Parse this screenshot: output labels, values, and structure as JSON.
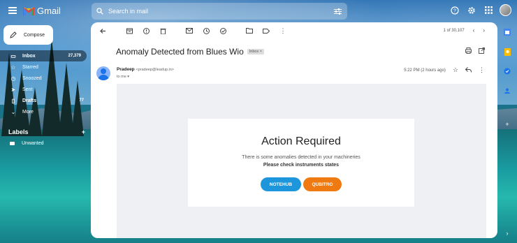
{
  "app": {
    "name": "Gmail"
  },
  "search": {
    "placeholder": "Search in mail"
  },
  "compose": {
    "label": "Compose"
  },
  "sidebar": {
    "items": [
      {
        "label": "Inbox",
        "count": "27,379",
        "icon": "inbox-icon"
      },
      {
        "label": "Starred",
        "count": "",
        "icon": "star-icon"
      },
      {
        "label": "Snoozed",
        "count": "",
        "icon": "clock-icon"
      },
      {
        "label": "Sent",
        "count": "",
        "icon": "send-icon"
      },
      {
        "label": "Drafts",
        "count": "77",
        "icon": "draft-icon"
      },
      {
        "label": "More",
        "count": "",
        "icon": "chevron-down-icon"
      }
    ],
    "labels_heading": "Labels",
    "labels_add": "+",
    "labels": [
      {
        "label": "Unwanted"
      }
    ]
  },
  "toolbar": {
    "pager": "1 of 30,107"
  },
  "email": {
    "subject": "Anomaly Detected from Blues Wio",
    "badge": "Inbox ×",
    "sender_name": "Pradeep",
    "sender_email": "<pradeep@leadup.in>",
    "to": "to me ▾",
    "time": "5:22 PM (2 hours ago)"
  },
  "card": {
    "title": "Action Required",
    "line1": "There is some anomalies detected in your machineries",
    "line2": "Please check instruments states",
    "btn1": "NOTEHUB",
    "btn2": "QUBITRO"
  },
  "colors": {
    "notehub": "#1e96db",
    "qubitro": "#f07a12"
  }
}
